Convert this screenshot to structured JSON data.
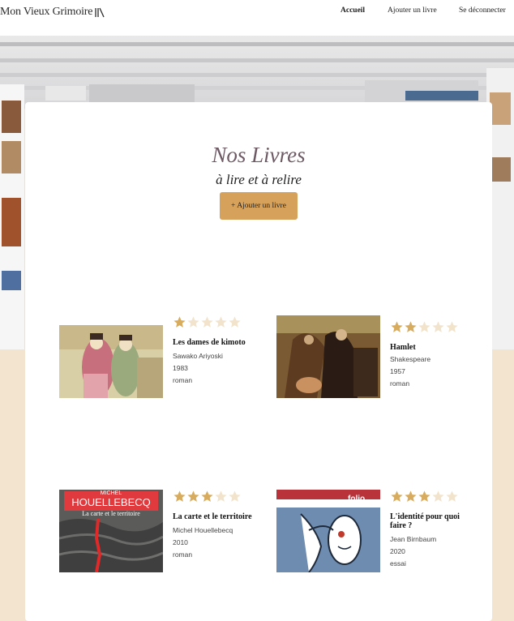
{
  "header": {
    "logo": "Mon Vieux Grimoire",
    "nav": [
      {
        "label": "Accueil",
        "active": true
      },
      {
        "label": "Ajouter un livre",
        "active": false
      },
      {
        "label": "Se déconnecter",
        "active": false
      }
    ]
  },
  "main": {
    "title": "Nos Livres",
    "subtitle": "à lire et à relire",
    "add_button": "+ Ajouter un livre"
  },
  "colors": {
    "accent": "#d6a15b",
    "star_filled": "#d8ac5e",
    "star_empty": "#f2e4cc",
    "background": "#f3e4cf"
  },
  "books": [
    {
      "title": "Les dames de kimoto",
      "author": "Sawako Ariyoski",
      "year": "1983",
      "genre": "roman",
      "rating": 1
    },
    {
      "title": "Hamlet",
      "author": "Shakespeare",
      "year": "1957",
      "genre": "roman",
      "rating": 2
    },
    {
      "title": "La carte et le territoire",
      "author": "Michel Houellebecq",
      "year": "2010",
      "genre": "roman",
      "rating": 3,
      "cover_text_top": "MICHEL",
      "cover_text_name": "HOUELLEBECQ",
      "cover_text_title": "La carte et le territoire"
    },
    {
      "title": "L'identité pour quoi faire ?",
      "author": "Jean Birnbaum",
      "year": "2020",
      "genre": "essai",
      "rating": 3,
      "cover_text_brand": "folio"
    }
  ]
}
